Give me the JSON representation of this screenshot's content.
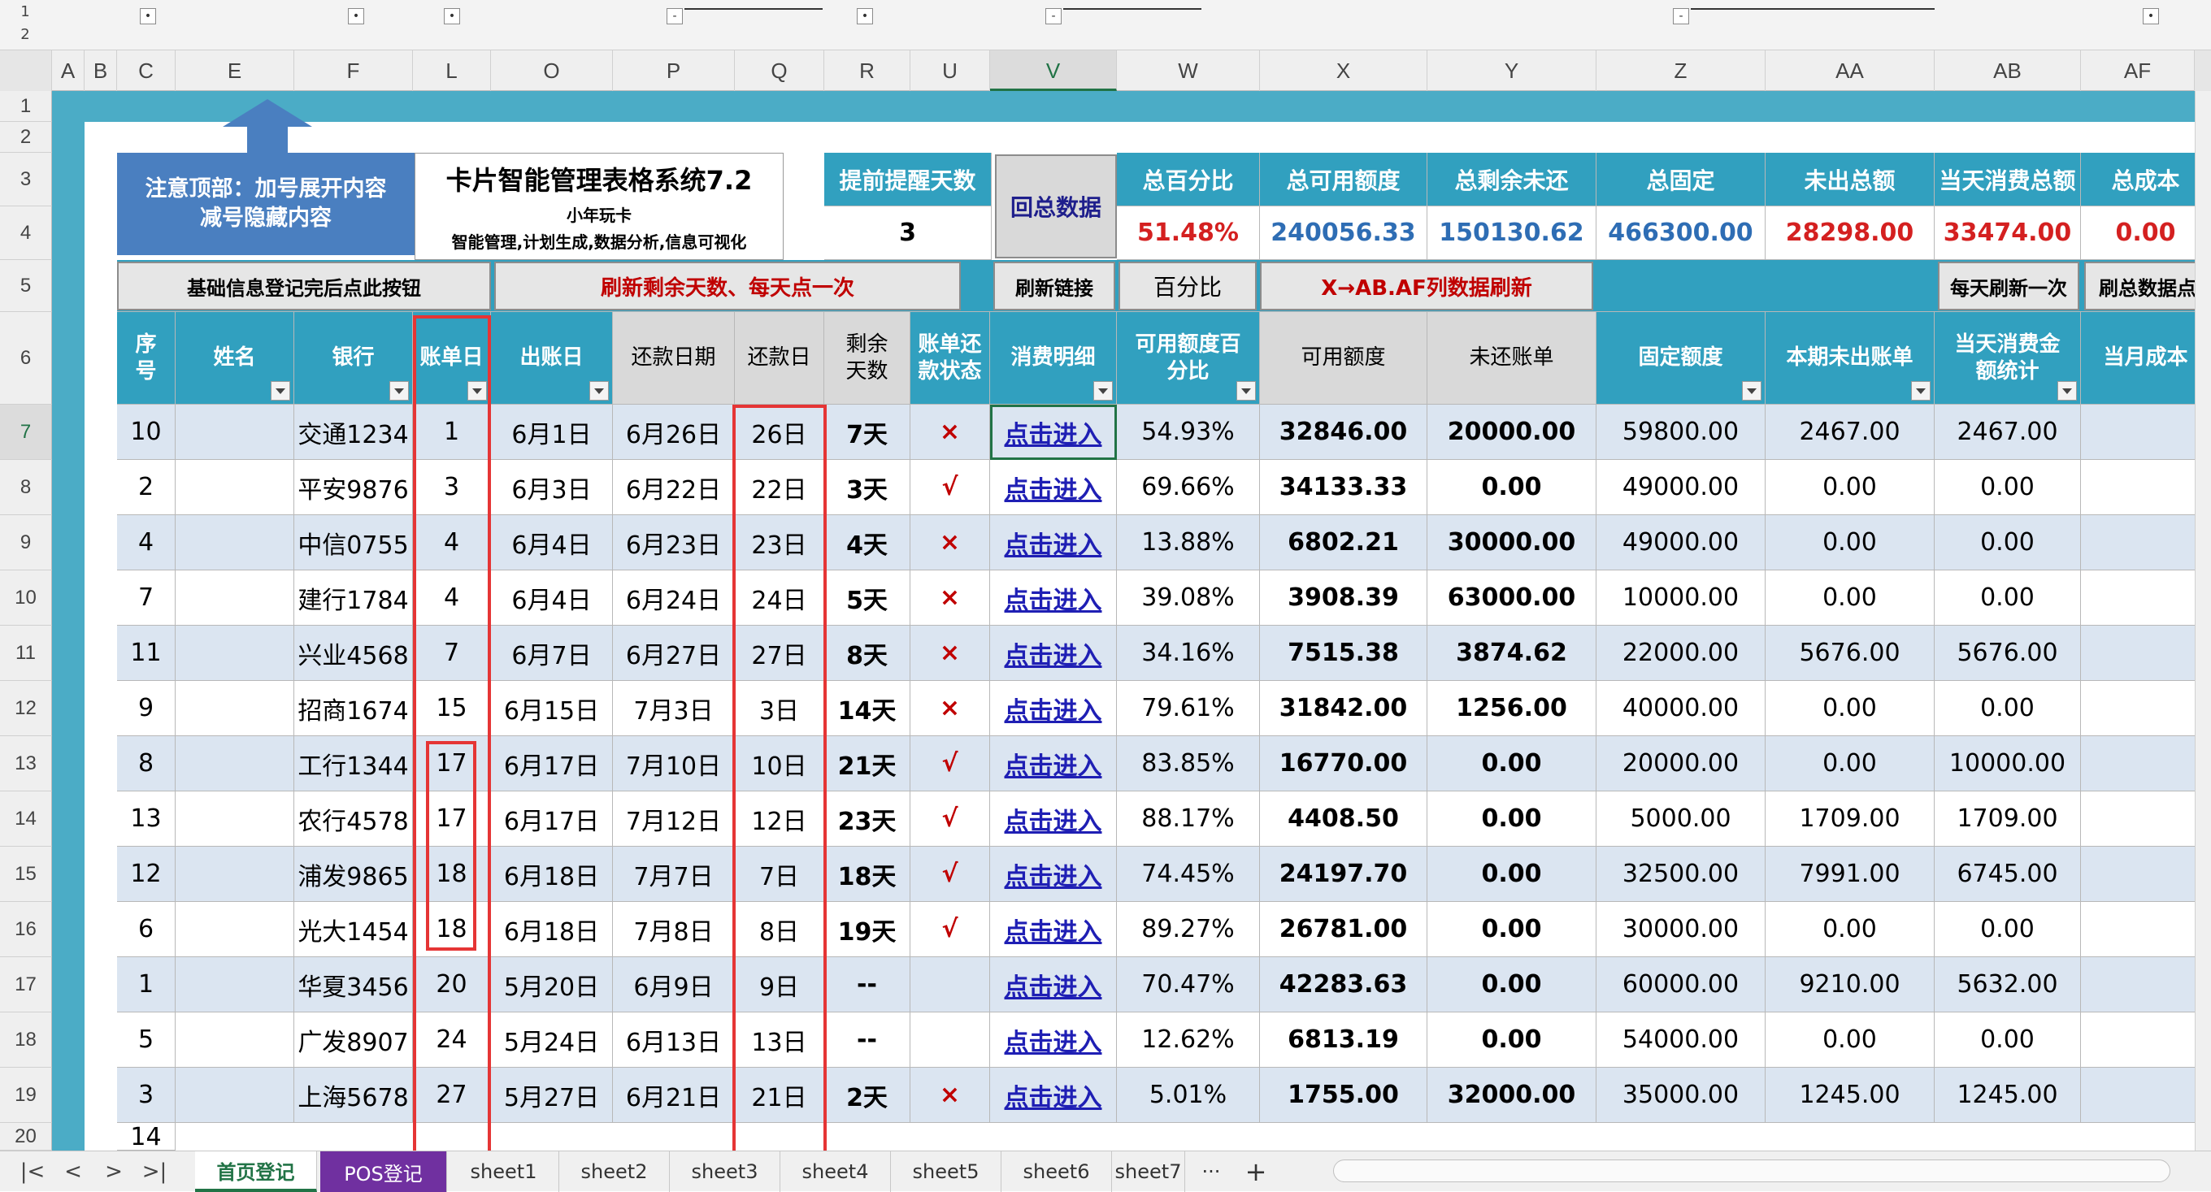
{
  "outline": {
    "levels": [
      "1",
      "2"
    ],
    "expand_glyph": "•",
    "collapse_glyph": "-"
  },
  "columns": [
    "A",
    "B",
    "C",
    "E",
    "F",
    "L",
    "O",
    "P",
    "Q",
    "R",
    "U",
    "V",
    "W",
    "X",
    "Y",
    "Z",
    "AA",
    "AB",
    "AF"
  ],
  "selected_column": "V",
  "rows": [
    "1",
    "2",
    "3",
    "4",
    "5",
    "6",
    "7",
    "8",
    "9",
    "10",
    "11",
    "12",
    "13",
    "14",
    "15",
    "16",
    "17",
    "18",
    "19",
    "20"
  ],
  "selected_row": "7",
  "notice": {
    "line1": "注意顶部：加号展开内容",
    "line2": "减号隐藏内容"
  },
  "title_box": {
    "title": "卡片智能管理表格系统7.2",
    "subtitle": "小年玩卡",
    "desc": "智能管理,计划生成,数据分析,信息可视化"
  },
  "reminder": {
    "label": "提前提醒天数",
    "value": "3"
  },
  "summary_button": "回总数据",
  "summary": {
    "headers": [
      "总百分比",
      "总可用额度",
      "总剩余未还",
      "总固定",
      "未出总额",
      "当天消费总额",
      "总成本"
    ],
    "values": [
      "51.48%",
      "240056.33",
      "150130.62",
      "466300.00",
      "28298.00",
      "33474.00",
      "0.00"
    ],
    "value_colors": [
      "#d42020",
      "#2e6db4",
      "#2e6db4",
      "#2e6db4",
      "#d42020",
      "#d42020",
      "#d42020"
    ]
  },
  "buttons": {
    "basic_info": "基础信息登记完后点此按钮",
    "refresh_days": "刷新剩余天数、每天点一次",
    "refresh_link": "刷新链接",
    "percent": "百分比",
    "x_refresh": "X→AB.AF列数据刷新",
    "daily_refresh": "每天刷新一次",
    "refresh_total": "刷总数据点"
  },
  "table_headers": {
    "seq": "序号",
    "name": "姓名",
    "bank": "银行",
    "bill_day": "账单日",
    "bill_date": "出账日",
    "repay_date": "还款日期",
    "repay_day": "还款日",
    "remaining": "剩余天数",
    "status": "账单还款状态",
    "detail": "消费明细",
    "avail_pct": "可用额度百分比",
    "avail": "可用额度",
    "unpaid": "未还账单",
    "fixed": "固定额度",
    "unbilled": "本期未出账单",
    "today": "当天消费金额统计",
    "cost": "当月成本"
  },
  "link_text": "点击进入",
  "table_rows": [
    {
      "seq": "10",
      "bank": "交通1234",
      "bill_day": "1",
      "bill_date": "6月1日",
      "repay_date": "6月26日",
      "repay_day": "26日",
      "remaining": "7天",
      "status": "×",
      "avail_pct": "54.93%",
      "avail": "32846.00",
      "unpaid": "20000.00",
      "fixed": "59800.00",
      "unbilled": "2467.00",
      "today": "2467.00"
    },
    {
      "seq": "2",
      "bank": "平安9876",
      "bill_day": "3",
      "bill_date": "6月3日",
      "repay_date": "6月22日",
      "repay_day": "22日",
      "remaining": "3天",
      "status": "√",
      "avail_pct": "69.66%",
      "avail": "34133.33",
      "unpaid": "0.00",
      "fixed": "49000.00",
      "unbilled": "0.00",
      "today": "0.00"
    },
    {
      "seq": "4",
      "bank": "中信0755",
      "bill_day": "4",
      "bill_date": "6月4日",
      "repay_date": "6月23日",
      "repay_day": "23日",
      "remaining": "4天",
      "status": "×",
      "avail_pct": "13.88%",
      "avail": "6802.21",
      "unpaid": "30000.00",
      "fixed": "49000.00",
      "unbilled": "0.00",
      "today": "0.00"
    },
    {
      "seq": "7",
      "bank": "建行1784",
      "bill_day": "4",
      "bill_date": "6月4日",
      "repay_date": "6月24日",
      "repay_day": "24日",
      "remaining": "5天",
      "status": "×",
      "avail_pct": "39.08%",
      "avail": "3908.39",
      "unpaid": "63000.00",
      "fixed": "10000.00",
      "unbilled": "0.00",
      "today": "0.00"
    },
    {
      "seq": "11",
      "bank": "兴业4568",
      "bill_day": "7",
      "bill_date": "6月7日",
      "repay_date": "6月27日",
      "repay_day": "27日",
      "remaining": "8天",
      "status": "×",
      "avail_pct": "34.16%",
      "avail": "7515.38",
      "unpaid": "3874.62",
      "fixed": "22000.00",
      "unbilled": "5676.00",
      "today": "5676.00"
    },
    {
      "seq": "9",
      "bank": "招商1674",
      "bill_day": "15",
      "bill_date": "6月15日",
      "repay_date": "7月3日",
      "repay_day": "3日",
      "remaining": "14天",
      "status": "×",
      "avail_pct": "79.61%",
      "avail": "31842.00",
      "unpaid": "1256.00",
      "fixed": "40000.00",
      "unbilled": "0.00",
      "today": "0.00"
    },
    {
      "seq": "8",
      "bank": "工行1344",
      "bill_day": "17",
      "bill_date": "6月17日",
      "repay_date": "7月10日",
      "repay_day": "10日",
      "remaining": "21天",
      "status": "√",
      "avail_pct": "83.85%",
      "avail": "16770.00",
      "unpaid": "0.00",
      "fixed": "20000.00",
      "unbilled": "0.00",
      "today": "10000.00"
    },
    {
      "seq": "13",
      "bank": "农行4578",
      "bill_day": "17",
      "bill_date": "6月17日",
      "repay_date": "7月12日",
      "repay_day": "12日",
      "remaining": "23天",
      "status": "√",
      "avail_pct": "88.17%",
      "avail": "4408.50",
      "unpaid": "0.00",
      "fixed": "5000.00",
      "unbilled": "1709.00",
      "today": "1709.00"
    },
    {
      "seq": "12",
      "bank": "浦发9865",
      "bill_day": "18",
      "bill_date": "6月18日",
      "repay_date": "7月7日",
      "repay_day": "7日",
      "remaining": "18天",
      "status": "√",
      "avail_pct": "74.45%",
      "avail": "24197.70",
      "unpaid": "0.00",
      "fixed": "32500.00",
      "unbilled": "7991.00",
      "today": "6745.00"
    },
    {
      "seq": "6",
      "bank": "光大1454",
      "bill_day": "18",
      "bill_date": "6月18日",
      "repay_date": "7月8日",
      "repay_day": "8日",
      "remaining": "19天",
      "status": "√",
      "avail_pct": "89.27%",
      "avail": "26781.00",
      "unpaid": "0.00",
      "fixed": "30000.00",
      "unbilled": "0.00",
      "today": "0.00"
    },
    {
      "seq": "1",
      "bank": "华夏3456",
      "bill_day": "20",
      "bill_date": "5月20日",
      "repay_date": "6月9日",
      "repay_day": "9日",
      "remaining": "--",
      "status": "",
      "avail_pct": "70.47%",
      "avail": "42283.63",
      "unpaid": "0.00",
      "fixed": "60000.00",
      "unbilled": "9210.00",
      "today": "5632.00"
    },
    {
      "seq": "5",
      "bank": "广发8907",
      "bill_day": "24",
      "bill_date": "5月24日",
      "repay_date": "6月13日",
      "repay_day": "13日",
      "remaining": "--",
      "status": "",
      "avail_pct": "12.62%",
      "avail": "6813.19",
      "unpaid": "0.00",
      "fixed": "54000.00",
      "unbilled": "0.00",
      "today": "0.00"
    },
    {
      "seq": "3",
      "bank": "上海5678",
      "bill_day": "27",
      "bill_date": "5月27日",
      "repay_date": "6月21日",
      "repay_day": "21日",
      "remaining": "2天",
      "status": "×",
      "avail_pct": "5.01%",
      "avail": "1755.00",
      "unpaid": "32000.00",
      "fixed": "35000.00",
      "unbilled": "1245.00",
      "today": "1245.00"
    }
  ],
  "partial_row": {
    "seq": "14"
  },
  "tabs": {
    "nav": [
      "|<",
      "<",
      ">",
      ">|"
    ],
    "sheets": [
      "首页登记",
      "POS登记",
      "sheet1",
      "sheet2",
      "sheet3",
      "sheet4",
      "sheet5",
      "sheet6",
      "sheet7"
    ],
    "more": "···",
    "add": "+"
  },
  "colors": {
    "frame": "#4bacc6",
    "header": "#31a0bf",
    "row_alt": "#dbe5f1",
    "highlight_box": "#e53535",
    "ok_mark": "#c00000",
    "link": "#1f1fb4",
    "notice_bg": "#4a7fc0"
  }
}
